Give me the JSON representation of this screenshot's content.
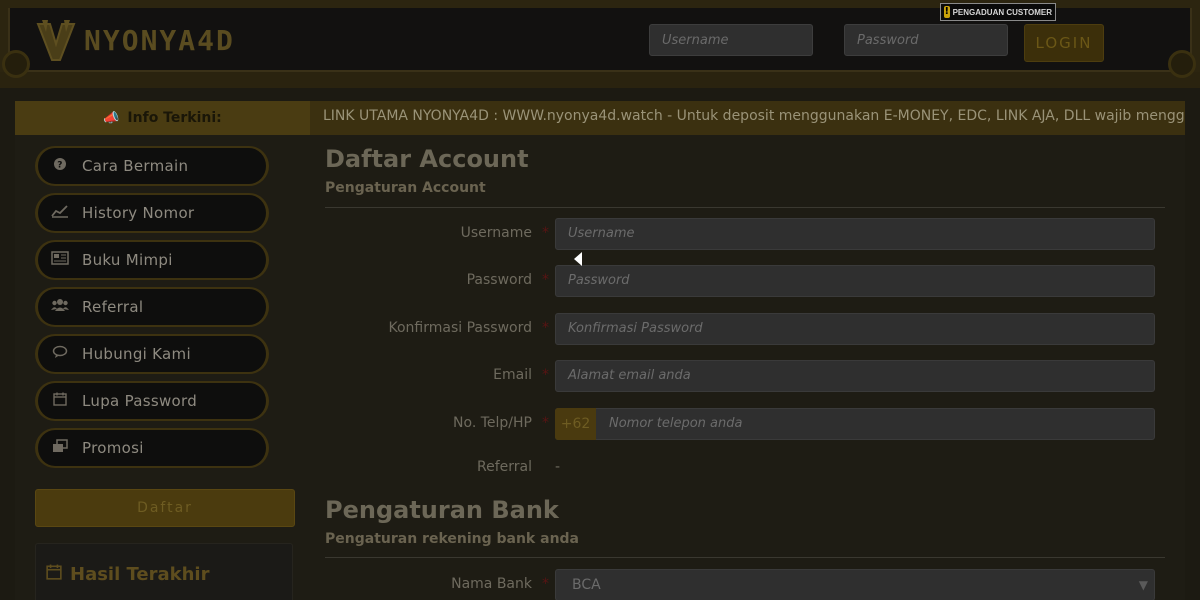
{
  "header": {
    "logo_text": "NYONYA4D",
    "username_placeholder": "Username",
    "password_placeholder": "Password",
    "login_label": "LOGIN",
    "pengaduan_label": "PENGADUAN CUSTOMER"
  },
  "info": {
    "label": "Info Terkini:",
    "marquee": "LINK UTAMA NYONYA4D : WWW.nyonya4d.watch - Untuk deposit menggunakan E-MONEY, EDC, LINK AJA, DLL wajib mengg"
  },
  "sidebar": {
    "items": [
      {
        "label": "Cara Bermain",
        "icon": "question-circle-icon"
      },
      {
        "label": "History Nomor",
        "icon": "line-chart-icon"
      },
      {
        "label": "Buku Mimpi",
        "icon": "newspaper-icon"
      },
      {
        "label": "Referral",
        "icon": "users-icon"
      },
      {
        "label": "Hubungi Kami",
        "icon": "chat-icon"
      },
      {
        "label": "Lupa Password",
        "icon": "calendar-icon"
      },
      {
        "label": "Promosi",
        "icon": "clone-icon"
      }
    ],
    "daftar_label": "Daftar",
    "hasil_title": "Hasil Terakhir"
  },
  "account": {
    "title": "Daftar Account",
    "subtitle": "Pengaturan Account",
    "fields": {
      "username": {
        "label": "Username",
        "placeholder": "Username"
      },
      "password": {
        "label": "Password",
        "placeholder": "Password"
      },
      "confirm": {
        "label": "Konfirmasi Password",
        "placeholder": "Konfirmasi Password"
      },
      "email": {
        "label": "Email",
        "placeholder": "Alamat email anda"
      },
      "phone": {
        "label": "No. Telp/HP",
        "prefix": "+62",
        "placeholder": "Nomor telepon anda"
      },
      "referral": {
        "label": "Referral",
        "value": "-"
      }
    },
    "required_mark": "*"
  },
  "bank": {
    "title": "Pengaturan Bank",
    "subtitle": "Pengaturan rekening bank anda",
    "bank_name_label": "Nama Bank",
    "bank_selected": "BCA"
  },
  "colors": {
    "gold": "#4b3b0e",
    "background": "#1c1a12"
  }
}
